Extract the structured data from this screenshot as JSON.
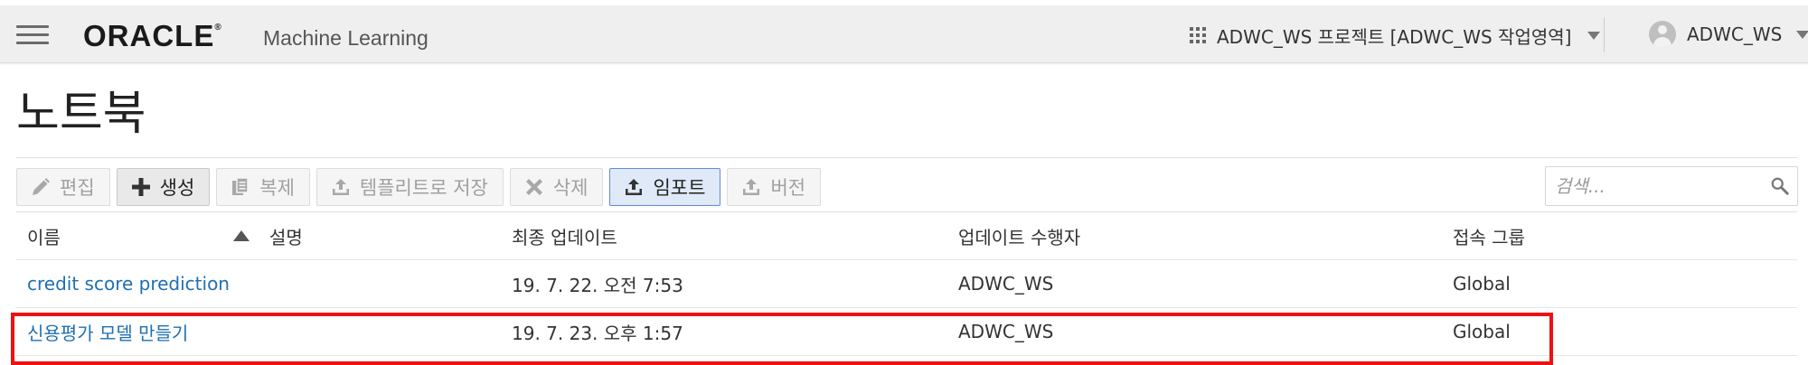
{
  "header": {
    "brand": "ORACLE",
    "brand_mark": "®",
    "app_name": "Machine Learning",
    "project": "ADWC_WS 프로젝트 [ADWC_WS 작업영역]",
    "user": "ADWC_WS"
  },
  "page": {
    "title": "노트북"
  },
  "toolbar": {
    "edit": "편집",
    "create": "생성",
    "duplicate": "복제",
    "save_template": "템플리트로 저장",
    "delete": "삭제",
    "import": "임포트",
    "version": "버전"
  },
  "search": {
    "placeholder": "검색..."
  },
  "table": {
    "columns": {
      "name": "이름",
      "description": "설명",
      "updated": "최종 업데이트",
      "updated_by": "업데이트 수행자",
      "access_group": "접속 그룹"
    },
    "rows": [
      {
        "name": "credit score prediction",
        "description": "",
        "updated": "19. 7. 22. 오전 7:53",
        "updated_by": "ADWC_WS",
        "access_group": "Global"
      },
      {
        "name": "신용평가 모델 만들기",
        "description": "",
        "updated": "19. 7. 23. 오후 1:57",
        "updated_by": "ADWC_WS",
        "access_group": "Global"
      }
    ]
  },
  "colors": {
    "link": "#1f6fb2",
    "highlight": "#ee1111",
    "header_bg": "#efefef",
    "import_border": "#5d8fd0"
  }
}
